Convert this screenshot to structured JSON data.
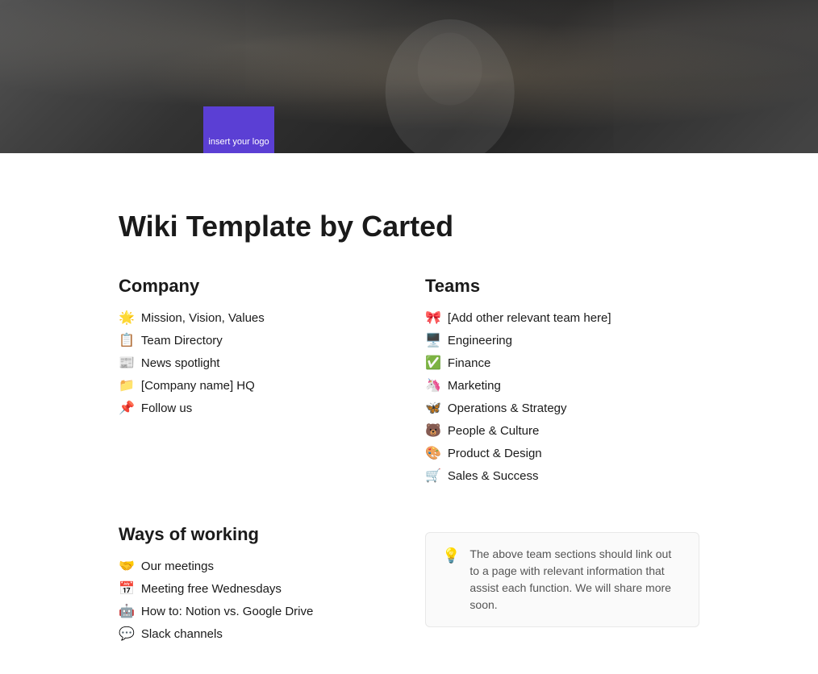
{
  "hero": {
    "alt": "Historical black and white photo of a woman working at a computer"
  },
  "logo": {
    "text": "insert your logo"
  },
  "page": {
    "title": "Wiki Template by Carted"
  },
  "company": {
    "section_title": "Company",
    "items": [
      {
        "emoji": "🌟",
        "label": "Mission, Vision, Values"
      },
      {
        "emoji": "📋",
        "label": "Team Directory"
      },
      {
        "emoji": "📰",
        "label": "News spotlight"
      },
      {
        "emoji": "📁",
        "label": "[Company name] HQ"
      },
      {
        "emoji": "📌",
        "label": "Follow us"
      }
    ]
  },
  "teams": {
    "section_title": "Teams",
    "items": [
      {
        "emoji": "🎀",
        "label": "[Add other relevant team here]"
      },
      {
        "emoji": "🖥️",
        "label": "Engineering"
      },
      {
        "emoji": "✅",
        "label": "Finance"
      },
      {
        "emoji": "🦄",
        "label": "Marketing"
      },
      {
        "emoji": "🦋",
        "label": "Operations & Strategy"
      },
      {
        "emoji": "🐻",
        "label": "People & Culture"
      },
      {
        "emoji": "🎨",
        "label": "Product & Design"
      },
      {
        "emoji": "🛒",
        "label": "Sales & Success"
      }
    ]
  },
  "ways_of_working": {
    "section_title": "Ways of working",
    "items": [
      {
        "emoji": "🤝",
        "label": "Our meetings"
      },
      {
        "emoji": "📅",
        "label": "Meeting free Wednesdays"
      },
      {
        "emoji": "🤖",
        "label": "How to: Notion vs. Google Drive"
      },
      {
        "emoji": "💬",
        "label": "Slack channels"
      }
    ]
  },
  "callout": {
    "icon": "💡",
    "text": "The above team sections should link out to a page with relevant information that assist each function. We will share more soon."
  }
}
